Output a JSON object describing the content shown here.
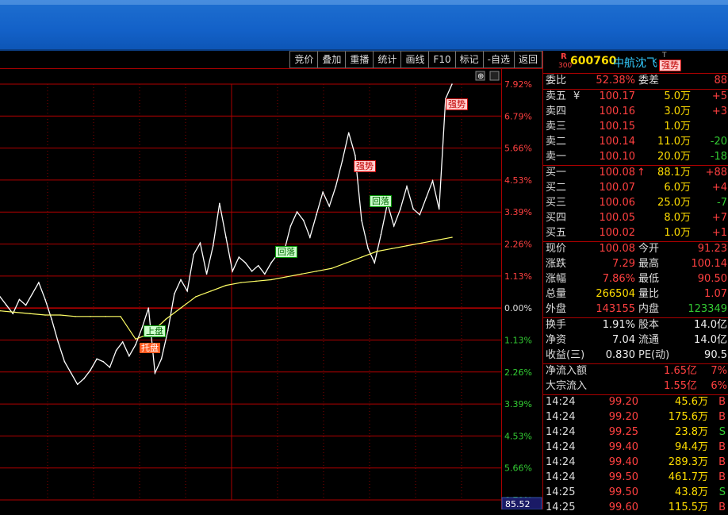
{
  "toolbar": {
    "items": [
      "竞价",
      "叠加",
      "重播",
      "统计",
      "画线",
      "F10",
      "标记",
      "-自选",
      "返回"
    ]
  },
  "chart": {
    "price_axis_top": "7.92%",
    "y_labels": [
      "7.92%",
      "6.79%",
      "5.66%",
      "4.53%",
      "3.39%",
      "2.26%",
      "1.13%",
      "0.00%",
      "1.13%",
      "2.26%",
      "3.39%",
      "4.53%",
      "5.66%",
      "6.79%"
    ],
    "bottom_value": "85.52",
    "annotations": [
      {
        "text": "强势",
        "style": "red"
      },
      {
        "text": "强势",
        "style": "red"
      },
      {
        "text": "回落",
        "style": "green"
      },
      {
        "text": "回落",
        "style": "green"
      },
      {
        "text": "上盘",
        "style": "green"
      },
      {
        "text": "托盘",
        "style": "orange"
      }
    ]
  },
  "chart_data": {
    "type": "line",
    "title": "",
    "xlabel": "",
    "ylabel": "",
    "ylim": [
      -6.79,
      7.92
    ],
    "series": [
      {
        "name": "",
        "values": [
          0.4,
          0.1,
          -0.2,
          0.3,
          0.1,
          0.5,
          0.9,
          0.3,
          -0.4,
          -1.2,
          -1.9,
          -2.3,
          -2.7,
          -2.5,
          -2.2,
          -1.8,
          -1.9,
          -2.1,
          -1.5,
          -1.2,
          -1.7,
          -1.3,
          -0.7,
          0.0,
          -2.3,
          -1.8,
          -0.8,
          0.5,
          1.0,
          0.6,
          1.9,
          2.3,
          1.2,
          2.2,
          3.7,
          2.5,
          1.3,
          1.8,
          1.6,
          1.3,
          1.5,
          1.2,
          1.6,
          1.9,
          2.0,
          2.9,
          3.4,
          3.1,
          2.5,
          3.3,
          4.1,
          3.6,
          4.3,
          5.2,
          6.2,
          5.4,
          3.1,
          2.1,
          1.6,
          2.6,
          3.7,
          2.9,
          3.5,
          4.3,
          3.5,
          3.3,
          3.9,
          4.5,
          3.5,
          7.4,
          7.92
        ]
      },
      {
        "name": "",
        "values": [
          -0.1,
          -0.15,
          -0.2,
          -0.25,
          -0.25,
          -0.3,
          -0.3,
          -0.3,
          -0.3,
          -1.1,
          -0.9,
          -0.4,
          0.0,
          0.4,
          0.6,
          0.8,
          0.9,
          0.95,
          1.0,
          1.1,
          1.2,
          1.3,
          1.4,
          1.6,
          1.8,
          2.0,
          2.1,
          2.2,
          2.3,
          2.4,
          2.5
        ]
      }
    ],
    "y_ticks": [
      "7.92%",
      "6.79%",
      "5.66%",
      "4.53%",
      "3.39%",
      "2.26%",
      "1.13%",
      "0.00%",
      "1.13%",
      "2.26%",
      "3.39%",
      "4.53%",
      "5.66%",
      "6.79%"
    ]
  },
  "quote": {
    "badge": "R",
    "badge_sub": "300",
    "code": "600760",
    "name": "中航沈飞",
    "name_suffix": "T",
    "header_tag": "强势",
    "weibi_label": "委比",
    "weibi_value": "52.38%",
    "weicha_label": "委差",
    "weicha_value": "88",
    "sell": [
      {
        "label": "卖五",
        "mark": "¥",
        "price": "100.17",
        "vol": "5.0万",
        "chg": "+5"
      },
      {
        "label": "卖四",
        "mark": "",
        "price": "100.16",
        "vol": "3.0万",
        "chg": "+3"
      },
      {
        "label": "卖三",
        "mark": "",
        "price": "100.15",
        "vol": "1.0万",
        "chg": ""
      },
      {
        "label": "卖二",
        "mark": "",
        "price": "100.14",
        "vol": "11.0万",
        "chg": "-20"
      },
      {
        "label": "卖一",
        "mark": "",
        "price": "100.10",
        "vol": "20.0万",
        "chg": "-18"
      }
    ],
    "buy": [
      {
        "label": "买一",
        "mark": "",
        "price": "100.08",
        "arrow": "↑",
        "vol": "88.1万",
        "chg": "+88"
      },
      {
        "label": "买二",
        "mark": "",
        "price": "100.07",
        "arrow": "",
        "vol": "6.0万",
        "chg": "+4"
      },
      {
        "label": "买三",
        "mark": "",
        "price": "100.06",
        "arrow": "",
        "vol": "25.0万",
        "chg": "-7"
      },
      {
        "label": "买四",
        "mark": "",
        "price": "100.05",
        "arrow": "",
        "vol": "8.0万",
        "chg": "+7"
      },
      {
        "label": "买五",
        "mark": "",
        "price": "100.02",
        "arrow": "",
        "vol": "1.0万",
        "chg": "+1"
      }
    ],
    "stats": [
      {
        "l1": "现价",
        "v1": "100.08",
        "c1": "red",
        "l2": "今开",
        "v2": "91.23",
        "c2": "red"
      },
      {
        "l1": "涨跌",
        "v1": "7.29",
        "c1": "red",
        "l2": "最高",
        "v2": "100.14",
        "c2": "red"
      },
      {
        "l1": "涨幅",
        "v1": "7.86%",
        "c1": "red",
        "l2": "最低",
        "v2": "90.50",
        "c2": "red"
      },
      {
        "l1": "总量",
        "v1": "266504",
        "c1": "yel",
        "l2": "量比",
        "v2": "1.07",
        "c2": "red"
      },
      {
        "l1": "外盘",
        "v1": "143155",
        "c1": "red",
        "l2": "内盘",
        "v2": "123349",
        "c2": "grn"
      }
    ],
    "stats2": [
      {
        "l1": "换手",
        "v1": "1.91%",
        "c1": "wht",
        "l2": "股本",
        "v2": "14.0亿",
        "c2": "wht"
      },
      {
        "l1": "净资",
        "v1": "7.04",
        "c1": "wht",
        "l2": "流通",
        "v2": "14.0亿",
        "c2": "wht"
      },
      {
        "l1": "收益(三)",
        "v1": "0.830",
        "c1": "wht",
        "l2": "PE(动)",
        "v2": "90.5",
        "c2": "wht"
      }
    ],
    "flow": [
      {
        "label": "净流入额",
        "value": "1.65亿",
        "pct": "7%"
      },
      {
        "label": "大宗流入",
        "value": "1.55亿",
        "pct": "6%"
      }
    ],
    "ticks": [
      {
        "time": "14:24",
        "price": "99.20",
        "vol": "45.6万",
        "side": "B"
      },
      {
        "time": "14:24",
        "price": "99.20",
        "vol": "175.6万",
        "side": "B"
      },
      {
        "time": "14:24",
        "price": "99.25",
        "vol": "23.8万",
        "side": "S"
      },
      {
        "time": "14:24",
        "price": "99.40",
        "vol": "94.4万",
        "side": "B"
      },
      {
        "time": "14:24",
        "price": "99.40",
        "vol": "289.3万",
        "side": "B"
      },
      {
        "time": "14:24",
        "price": "99.50",
        "vol": "461.7万",
        "side": "B"
      },
      {
        "time": "14:25",
        "price": "99.50",
        "vol": "43.8万",
        "side": "S"
      },
      {
        "time": "14:25",
        "price": "99.60",
        "vol": "115.5万",
        "side": "B"
      }
    ]
  }
}
